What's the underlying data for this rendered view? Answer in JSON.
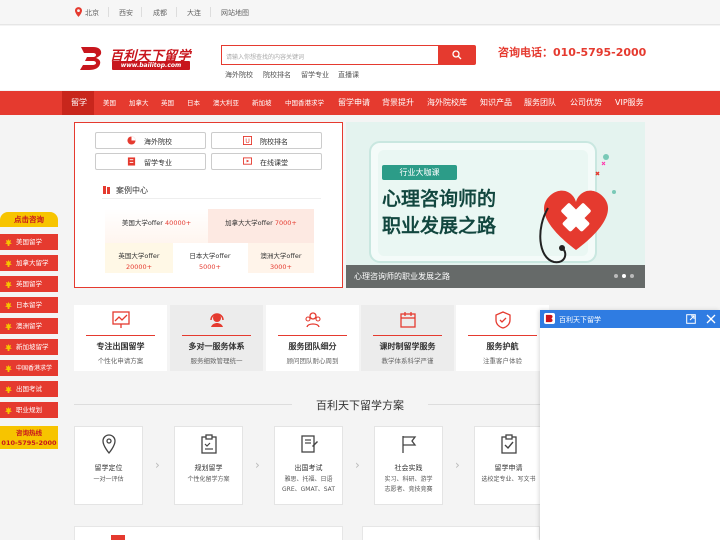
{
  "topbar": {
    "cities": [
      "北京",
      "西安",
      "成都",
      "大连",
      "网站地图"
    ]
  },
  "header": {
    "logo_text": "百利天下留学",
    "logo_url": "www.bailitop.com",
    "search_placeholder": "请输入你想查找的内容关键词",
    "hot_links": [
      "海外院校",
      "院校排名",
      "留学专业",
      "直播课"
    ],
    "phone": "咨询电话：010-5795-2000"
  },
  "nav": {
    "items": [
      "留学",
      "美国",
      "加拿大",
      "英国",
      "日本",
      "澳大利亚",
      "新加坡",
      "中国香港求学",
      "留学申请",
      "背景提升",
      "海外院校库",
      "知识产品",
      "服务团队",
      "公司优势",
      "VIP服务"
    ]
  },
  "quick": {
    "buttons": [
      "海外院校",
      "院校排名",
      "留学专业",
      "在线课堂"
    ]
  },
  "cases": {
    "title": "案例中心",
    "items": [
      {
        "label": "美国大学offer",
        "num": "40000+"
      },
      {
        "label": "加拿大大学offer",
        "num": "7000+"
      },
      {
        "label": "英国大学offer",
        "num": "20000+"
      },
      {
        "label": "日本大学offer",
        "num": "5000+"
      },
      {
        "label": "澳洲大学offer",
        "num": "3000+"
      }
    ]
  },
  "banner": {
    "tag": "行业大咖课",
    "line1": "心理咨询师的",
    "line2": "职业发展之路",
    "caption": "心理咨询师的职业发展之路"
  },
  "float": {
    "head": "点击咨询",
    "items": [
      "美国留学",
      "加拿大留学",
      "英国留学",
      "日本留学",
      "澳洲留学",
      "新加坡留学",
      "中国香港求学",
      "出国考试",
      "职业规划"
    ],
    "hotline_label": "咨询热线",
    "hotline": "010-5795-2000"
  },
  "features": [
    {
      "title": "专注出国留学",
      "sub": "个性化申请方案"
    },
    {
      "title": "多对一服务体系",
      "sub": "服务细致管理统一"
    },
    {
      "title": "服务团队细分",
      "sub": "顾问团队耐心周到"
    },
    {
      "title": "课时制留学服务",
      "sub": "教学体系科学严谨"
    },
    {
      "title": "服务护航",
      "sub": "注重客户体验"
    }
  ],
  "plan": {
    "title": "百利天下留学方案",
    "cards": [
      {
        "title": "留学定位",
        "sub": "一对一评估"
      },
      {
        "title": "规划留学",
        "sub": "个性化留学方案"
      },
      {
        "title": "出国考试",
        "sub": "雅思、托福、日语\nGRE、GMAT、SAT"
      },
      {
        "title": "社会实践",
        "sub": "实习、科研、游学\n志愿者、竞技竞赛"
      },
      {
        "title": "留学申请",
        "sub": "选校定专业、写文书"
      }
    ]
  },
  "popup": {
    "title": "百利天下留学"
  },
  "colors": {
    "brand_red": "#e53a2f",
    "accent_yellow": "#f7c400",
    "popup_blue": "#2f7ce2"
  }
}
